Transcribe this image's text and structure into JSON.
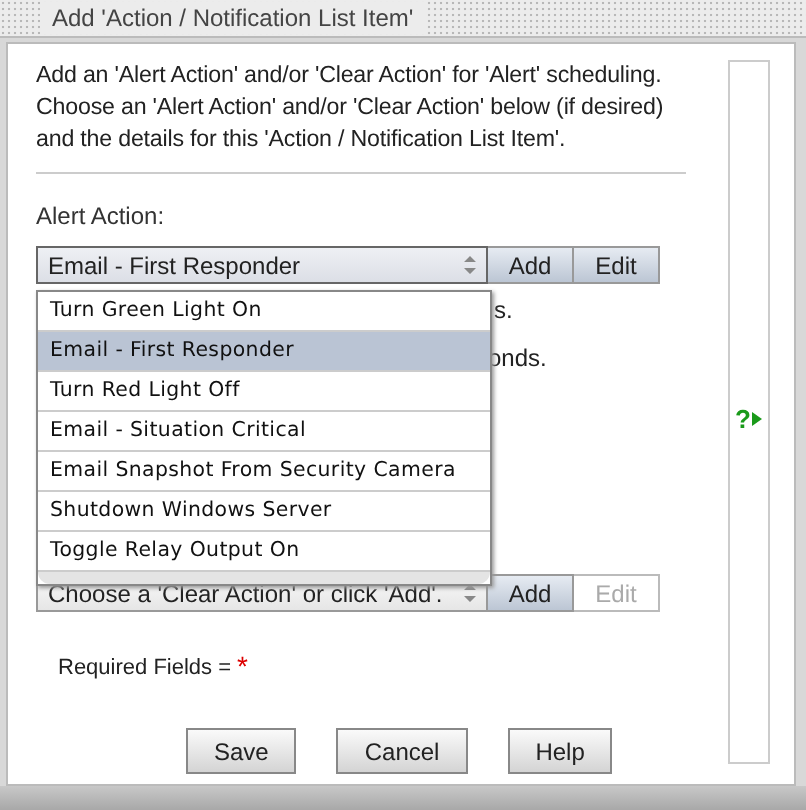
{
  "window": {
    "title": "Add 'Action / Notification List Item'"
  },
  "intro": "Add an 'Alert Action' and/or 'Clear Action' for 'Alert' scheduling. Choose an 'Alert Action' and/or 'Clear Action' below (if desired) and the details for this 'Action / Notification List Item'.",
  "alert_action": {
    "label": "Alert Action:",
    "value": "Email - First Responder",
    "expanded": true,
    "options": [
      {
        "label": "Turn Green Light On",
        "selected": false
      },
      {
        "label": "Email - First Responder",
        "selected": true
      },
      {
        "label": "Turn Red Light Off",
        "selected": false
      },
      {
        "label": "Email - Situation Critical",
        "selected": false
      },
      {
        "label": "Email Snapshot From Security Camera",
        "selected": false
      },
      {
        "label": "Shutdown Windows Server",
        "selected": false
      },
      {
        "label": "Toggle Relay Output On",
        "selected": false
      }
    ],
    "buttons": [
      {
        "label": "Add",
        "disabled": false
      },
      {
        "label": "Edit",
        "disabled": false
      }
    ]
  },
  "partly_hidden_lines": [
    "s.",
    "onds."
  ],
  "clear_action": {
    "value": "Choose a 'Clear Action' or click 'Add'.",
    "expanded": false,
    "buttons": [
      {
        "label": "Add",
        "disabled": false
      },
      {
        "label": "Edit",
        "disabled": true
      }
    ]
  },
  "required_note": {
    "label": "Required Fields =",
    "marker": "*"
  },
  "help_link": "?",
  "buttons": [
    "Save",
    "Cancel",
    "Help"
  ]
}
